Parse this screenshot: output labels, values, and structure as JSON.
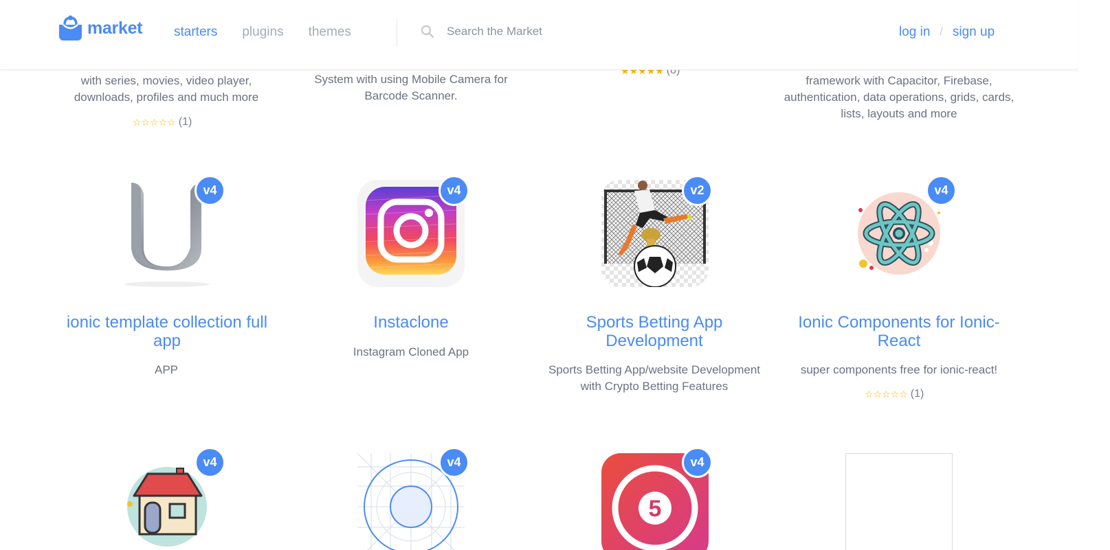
{
  "header": {
    "brand": "market",
    "nav": [
      {
        "label": "starters",
        "active": true
      },
      {
        "label": "plugins",
        "active": false
      },
      {
        "label": "themes",
        "active": false
      }
    ],
    "search_placeholder": "Search the Market",
    "login": "log in",
    "separator": "/",
    "signup": "sign up"
  },
  "previous_row": {
    "col1_text": "with series, movies, video player, downloads, profiles and much more",
    "col1_rating": "(1)",
    "col2_text": "System with using Mobile Camera for Barcode Scanner.",
    "col3_rating": "(8)",
    "col4_text": "framework with Capacitor, Firebase, authentication, data operations, grids, cards, lists, layouts and more"
  },
  "cards": [
    {
      "badge": "v4",
      "title": "ionic template collection full app",
      "desc": "APP",
      "rating": ""
    },
    {
      "badge": "v4",
      "title": "Instaclone",
      "desc": "Instagram Cloned App",
      "rating": ""
    },
    {
      "badge": "v2",
      "title": "Sports Betting App Development",
      "desc": "Sports Betting App/website Development with Crypto Betting Features",
      "rating": ""
    },
    {
      "badge": "v4",
      "title": "Ionic Components for Ionic-React",
      "desc": "super components free for ionic-react!",
      "rating": "(1)"
    }
  ],
  "next_row": [
    {
      "badge": "v4",
      "icon": "house-icon"
    },
    {
      "badge": "v4",
      "icon": "blueprint-icon"
    },
    {
      "badge": "v4",
      "icon": "five-icon",
      "number": "5"
    },
    {
      "badge": "",
      "icon": "blank-thumbnail"
    }
  ],
  "colors": {
    "accent": "#4a8bf5",
    "text": "#6b7280",
    "star": "#f5b301"
  }
}
